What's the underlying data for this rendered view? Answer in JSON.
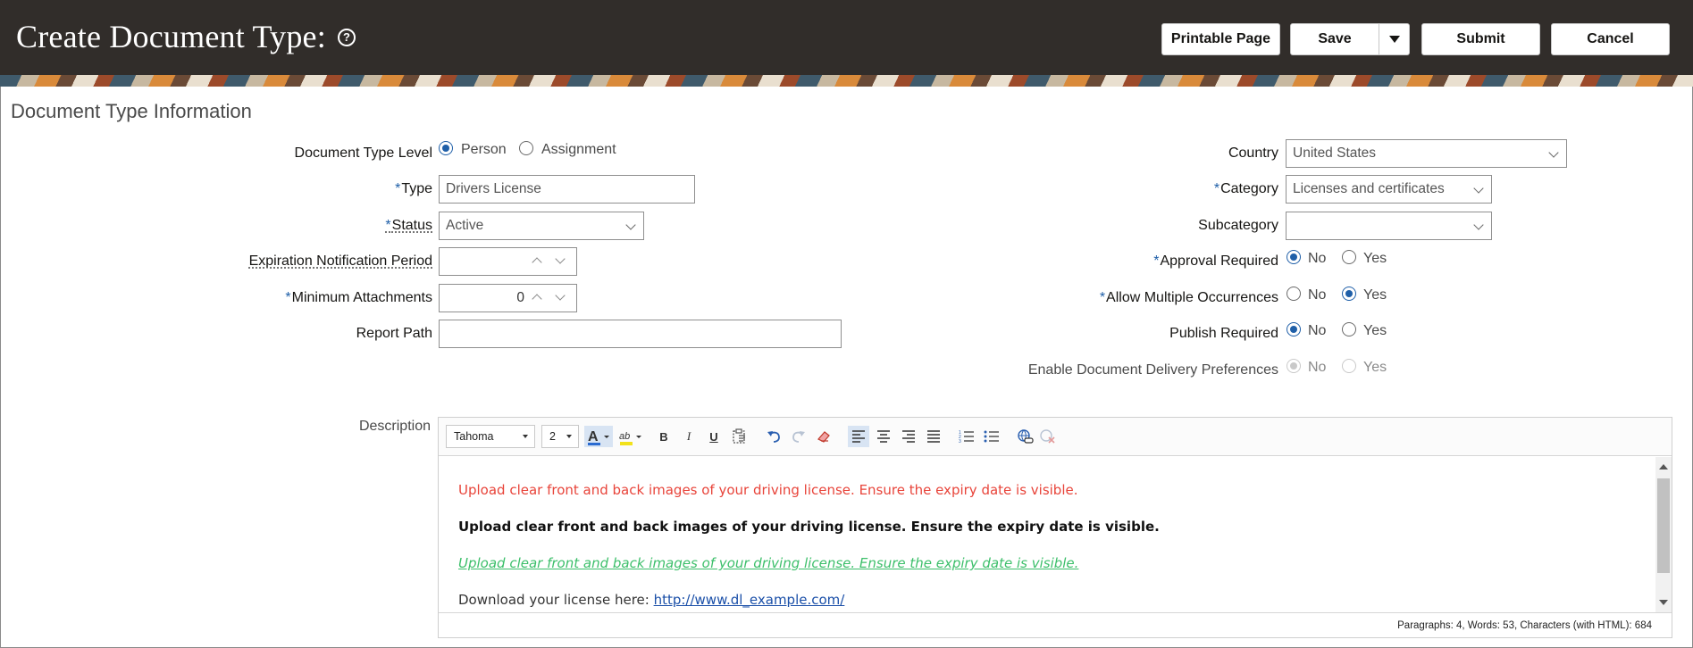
{
  "header": {
    "title": "Create Document Type:",
    "buttons": {
      "printable": "Printable Page",
      "save": "Save",
      "submit": "Submit",
      "cancel": "Cancel"
    }
  },
  "section_title": "Document Type Information",
  "left_form": {
    "document_type_level": {
      "label": "Document Type Level",
      "options": [
        "Person",
        "Assignment"
      ],
      "selected": "Person"
    },
    "type": {
      "label": "Type",
      "value": "Drivers License"
    },
    "status": {
      "label": "Status",
      "value": "Active"
    },
    "expiration_notification_period": {
      "label": "Expiration Notification Period",
      "value": ""
    },
    "minimum_attachments": {
      "label": "Minimum Attachments",
      "value": "0"
    },
    "report_path": {
      "label": "Report Path",
      "value": ""
    },
    "required_marker": "*"
  },
  "right_form": {
    "country": {
      "label": "Country",
      "value": "United States"
    },
    "category": {
      "label": "Category",
      "value": "Licenses and certificates"
    },
    "subcategory": {
      "label": "Subcategory",
      "value": ""
    },
    "approval_required": {
      "label": "Approval Required",
      "options": [
        "No",
        "Yes"
      ],
      "selected": "No"
    },
    "allow_multiple_occurrences": {
      "label": "Allow Multiple Occurrences",
      "options": [
        "No",
        "Yes"
      ],
      "selected": "Yes"
    },
    "publish_required": {
      "label": "Publish Required",
      "options": [
        "No",
        "Yes"
      ],
      "selected": "No"
    },
    "enable_document_delivery_preferences": {
      "label": "Enable Document Delivery Preferences",
      "options": [
        "No",
        "Yes"
      ],
      "selected": "No",
      "disabled": true
    }
  },
  "description": {
    "label": "Description",
    "toolbar": {
      "font_family": "Tahoma",
      "font_size": "2"
    },
    "paragraphs": [
      "Upload clear front and back images of your driving license. Ensure the expiry date is visible.",
      "Upload clear front and back images of your driving license. Ensure the expiry date is visible.",
      "Upload clear front and back images of your driving license. Ensure the expiry date is visible."
    ],
    "download_prefix": "Download your license here: ",
    "download_link": "http://www.dl_example.com/",
    "status": "Paragraphs: 4, Words: 53, Characters (with HTML): 684"
  },
  "colors": {
    "header_bg": "#312d2a",
    "required_marker": "#1f5fa8",
    "radio_selected": "#1f5fa8",
    "text_red": "#e8443a",
    "text_green": "#3cbf6a",
    "link": "#1a4fa8"
  }
}
